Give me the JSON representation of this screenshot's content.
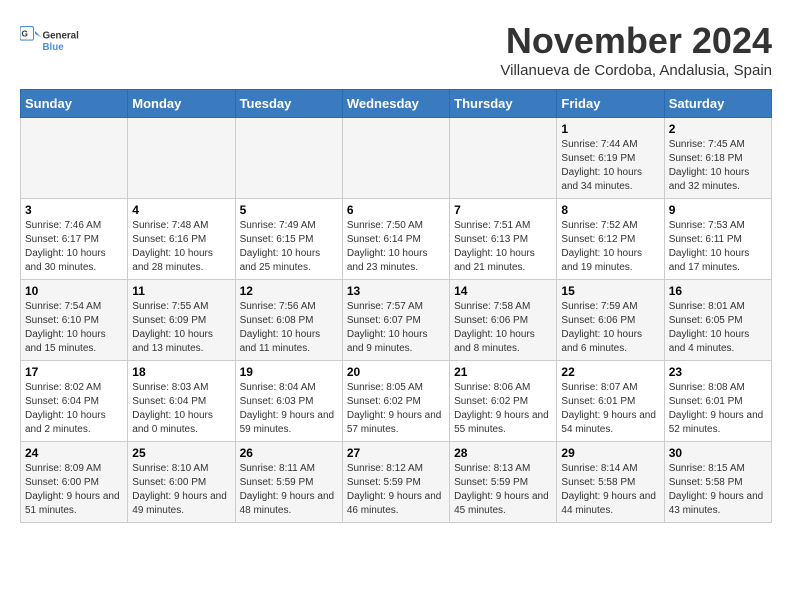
{
  "logo": {
    "line1": "General",
    "line2": "Blue"
  },
  "title": "November 2024",
  "subtitle": "Villanueva de Cordoba, Andalusia, Spain",
  "weekdays": [
    "Sunday",
    "Monday",
    "Tuesday",
    "Wednesday",
    "Thursday",
    "Friday",
    "Saturday"
  ],
  "weeks": [
    [
      {
        "day": "",
        "info": ""
      },
      {
        "day": "",
        "info": ""
      },
      {
        "day": "",
        "info": ""
      },
      {
        "day": "",
        "info": ""
      },
      {
        "day": "",
        "info": ""
      },
      {
        "day": "1",
        "info": "Sunrise: 7:44 AM\nSunset: 6:19 PM\nDaylight: 10 hours and 34 minutes."
      },
      {
        "day": "2",
        "info": "Sunrise: 7:45 AM\nSunset: 6:18 PM\nDaylight: 10 hours and 32 minutes."
      }
    ],
    [
      {
        "day": "3",
        "info": "Sunrise: 7:46 AM\nSunset: 6:17 PM\nDaylight: 10 hours and 30 minutes."
      },
      {
        "day": "4",
        "info": "Sunrise: 7:48 AM\nSunset: 6:16 PM\nDaylight: 10 hours and 28 minutes."
      },
      {
        "day": "5",
        "info": "Sunrise: 7:49 AM\nSunset: 6:15 PM\nDaylight: 10 hours and 25 minutes."
      },
      {
        "day": "6",
        "info": "Sunrise: 7:50 AM\nSunset: 6:14 PM\nDaylight: 10 hours and 23 minutes."
      },
      {
        "day": "7",
        "info": "Sunrise: 7:51 AM\nSunset: 6:13 PM\nDaylight: 10 hours and 21 minutes."
      },
      {
        "day": "8",
        "info": "Sunrise: 7:52 AM\nSunset: 6:12 PM\nDaylight: 10 hours and 19 minutes."
      },
      {
        "day": "9",
        "info": "Sunrise: 7:53 AM\nSunset: 6:11 PM\nDaylight: 10 hours and 17 minutes."
      }
    ],
    [
      {
        "day": "10",
        "info": "Sunrise: 7:54 AM\nSunset: 6:10 PM\nDaylight: 10 hours and 15 minutes."
      },
      {
        "day": "11",
        "info": "Sunrise: 7:55 AM\nSunset: 6:09 PM\nDaylight: 10 hours and 13 minutes."
      },
      {
        "day": "12",
        "info": "Sunrise: 7:56 AM\nSunset: 6:08 PM\nDaylight: 10 hours and 11 minutes."
      },
      {
        "day": "13",
        "info": "Sunrise: 7:57 AM\nSunset: 6:07 PM\nDaylight: 10 hours and 9 minutes."
      },
      {
        "day": "14",
        "info": "Sunrise: 7:58 AM\nSunset: 6:06 PM\nDaylight: 10 hours and 8 minutes."
      },
      {
        "day": "15",
        "info": "Sunrise: 7:59 AM\nSunset: 6:06 PM\nDaylight: 10 hours and 6 minutes."
      },
      {
        "day": "16",
        "info": "Sunrise: 8:01 AM\nSunset: 6:05 PM\nDaylight: 10 hours and 4 minutes."
      }
    ],
    [
      {
        "day": "17",
        "info": "Sunrise: 8:02 AM\nSunset: 6:04 PM\nDaylight: 10 hours and 2 minutes."
      },
      {
        "day": "18",
        "info": "Sunrise: 8:03 AM\nSunset: 6:04 PM\nDaylight: 10 hours and 0 minutes."
      },
      {
        "day": "19",
        "info": "Sunrise: 8:04 AM\nSunset: 6:03 PM\nDaylight: 9 hours and 59 minutes."
      },
      {
        "day": "20",
        "info": "Sunrise: 8:05 AM\nSunset: 6:02 PM\nDaylight: 9 hours and 57 minutes."
      },
      {
        "day": "21",
        "info": "Sunrise: 8:06 AM\nSunset: 6:02 PM\nDaylight: 9 hours and 55 minutes."
      },
      {
        "day": "22",
        "info": "Sunrise: 8:07 AM\nSunset: 6:01 PM\nDaylight: 9 hours and 54 minutes."
      },
      {
        "day": "23",
        "info": "Sunrise: 8:08 AM\nSunset: 6:01 PM\nDaylight: 9 hours and 52 minutes."
      }
    ],
    [
      {
        "day": "24",
        "info": "Sunrise: 8:09 AM\nSunset: 6:00 PM\nDaylight: 9 hours and 51 minutes."
      },
      {
        "day": "25",
        "info": "Sunrise: 8:10 AM\nSunset: 6:00 PM\nDaylight: 9 hours and 49 minutes."
      },
      {
        "day": "26",
        "info": "Sunrise: 8:11 AM\nSunset: 5:59 PM\nDaylight: 9 hours and 48 minutes."
      },
      {
        "day": "27",
        "info": "Sunrise: 8:12 AM\nSunset: 5:59 PM\nDaylight: 9 hours and 46 minutes."
      },
      {
        "day": "28",
        "info": "Sunrise: 8:13 AM\nSunset: 5:59 PM\nDaylight: 9 hours and 45 minutes."
      },
      {
        "day": "29",
        "info": "Sunrise: 8:14 AM\nSunset: 5:58 PM\nDaylight: 9 hours and 44 minutes."
      },
      {
        "day": "30",
        "info": "Sunrise: 8:15 AM\nSunset: 5:58 PM\nDaylight: 9 hours and 43 minutes."
      }
    ]
  ]
}
